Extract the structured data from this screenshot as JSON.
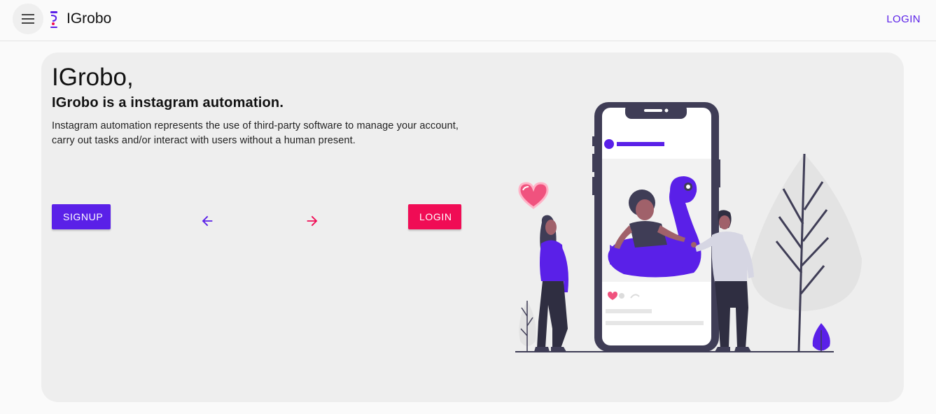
{
  "appbar": {
    "brand": "IGrobo",
    "login_label": "LOGIN",
    "menu_icon": "menu-icon",
    "logo_icon": "logo-icon"
  },
  "hero": {
    "heading": "IGrobo,",
    "subheading": "IGrobo is a instagram automation.",
    "description": "Instagram automation represents the use of third-party software to manage your account, carry out tasks and/or interact with users without a human present.",
    "signup_label": "SIGNUP",
    "login_label": "LOGIN",
    "back_icon": "arrow-back-icon",
    "forward_icon": "arrow-forward-icon"
  },
  "colors": {
    "primary": "#5a20e8",
    "accent": "#f00c55",
    "card_background": "#eeeeee",
    "page_background": "#fafafa"
  }
}
